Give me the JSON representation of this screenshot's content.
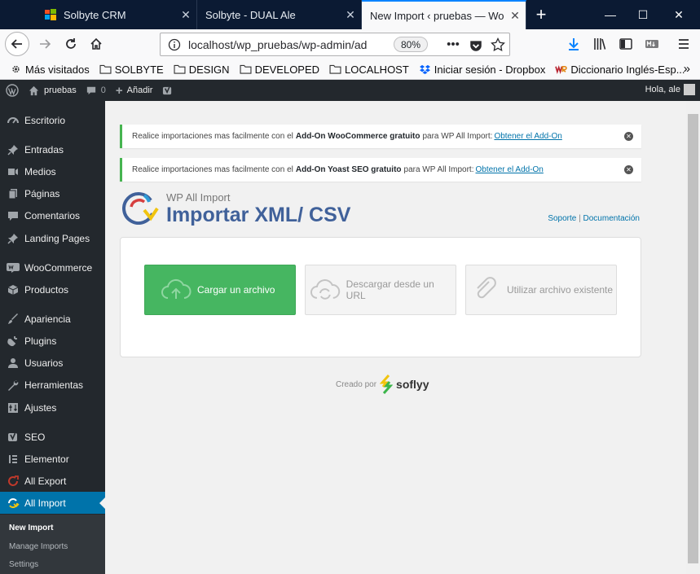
{
  "browser": {
    "tabs": [
      {
        "title": "Solbyte CRM",
        "active": false
      },
      {
        "title": "Solbyte - DUAL Ale",
        "active": false
      },
      {
        "title": "New Import ‹ pruebas — Word",
        "active": true
      }
    ],
    "new_tab_symbol": "+",
    "window_controls": [
      "—",
      "☐",
      "✕"
    ],
    "url": "localhost/wp_pruebas/wp-admin/ad",
    "zoom": "80%",
    "bookmarks": [
      {
        "label": "Más visitados",
        "icon": "gear-icon"
      },
      {
        "label": "SOLBYTE",
        "icon": "folder-icon"
      },
      {
        "label": "DESIGN",
        "icon": "folder-icon"
      },
      {
        "label": "DEVELOPED",
        "icon": "folder-icon"
      },
      {
        "label": "LOCALHOST",
        "icon": "folder-icon"
      },
      {
        "label": "Iniciar sesión - Dropbox",
        "icon": "dropbox-icon"
      },
      {
        "label": "Diccionario Inglés-Esp...",
        "icon": "wordreference-icon"
      }
    ]
  },
  "adminbar": {
    "site_name": "pruebas",
    "comments_count": "0",
    "add_new": "Añadir",
    "greeting": "Hola, ale"
  },
  "sidebar": {
    "items": [
      {
        "label": "Escritorio",
        "icon": "dashboard-icon"
      },
      {
        "label": "Entradas",
        "icon": "pin-icon"
      },
      {
        "label": "Medios",
        "icon": "media-icon"
      },
      {
        "label": "Páginas",
        "icon": "pages-icon"
      },
      {
        "label": "Comentarios",
        "icon": "comment-icon"
      },
      {
        "label": "Landing Pages",
        "icon": "pin-icon"
      },
      {
        "label": "WooCommerce",
        "icon": "woo-icon"
      },
      {
        "label": "Productos",
        "icon": "box-icon"
      },
      {
        "label": "Apariencia",
        "icon": "brush-icon"
      },
      {
        "label": "Plugins",
        "icon": "plug-icon"
      },
      {
        "label": "Usuarios",
        "icon": "user-icon"
      },
      {
        "label": "Herramientas",
        "icon": "wrench-icon"
      },
      {
        "label": "Ajustes",
        "icon": "settings-icon"
      },
      {
        "label": "SEO",
        "icon": "yoast-icon"
      },
      {
        "label": "Elementor",
        "icon": "elementor-icon"
      },
      {
        "label": "All Export",
        "icon": "export-icon"
      },
      {
        "label": "All Import",
        "icon": "import-icon"
      }
    ],
    "submenu": [
      {
        "label": "New Import",
        "current": true
      },
      {
        "label": "Manage Imports",
        "current": false
      },
      {
        "label": "Settings",
        "current": false
      }
    ]
  },
  "notices": [
    {
      "prefix": "Realice importaciones mas facilmente con el",
      "addon": "Add-On WooCommerce gratuito",
      "suffix": "para WP All Import:",
      "link": "Obtener el Add-On"
    },
    {
      "prefix": "Realice importaciones mas facilmente con el",
      "addon": "Add-On Yoast SEO gratuito",
      "suffix": "para WP All Import:",
      "link": "Obtener el Add-On"
    }
  ],
  "header": {
    "plugin_name": "WP All Import",
    "title": "Importar XML/ CSV",
    "support_link": "Soporte",
    "separator": "|",
    "docs_link": "Documentación"
  },
  "choices": [
    {
      "label": "Cargar un archivo",
      "icon": "upload-cloud-icon"
    },
    {
      "label": "Descargar desde un URL",
      "icon": "download-cloud-icon"
    },
    {
      "label": "Utilizar archivo existente",
      "icon": "paperclip-icon"
    }
  ],
  "footer": {
    "created_by": "Creado por",
    "brand": "soflyy"
  },
  "colors": {
    "primary_button": "#46b661",
    "wp_accent": "#0073aa",
    "notice_border": "#46b450",
    "title": "#40619a"
  }
}
